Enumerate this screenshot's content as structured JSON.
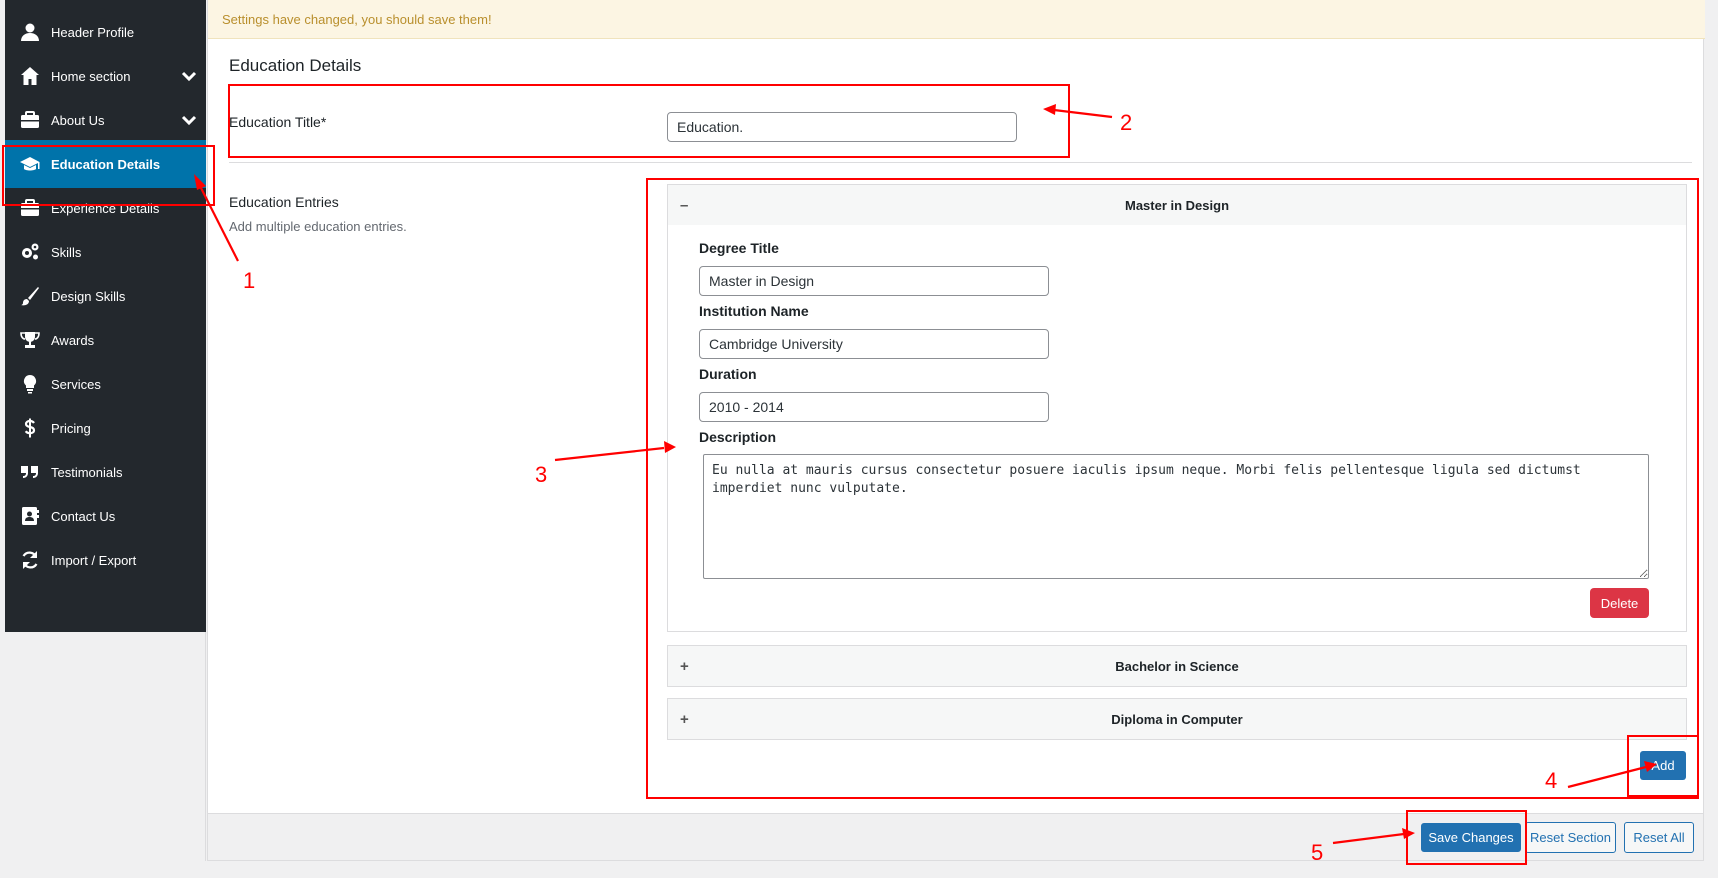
{
  "sidebar": {
    "items": [
      {
        "label": "Header Profile",
        "icon": "user-icon"
      },
      {
        "label": "Home section",
        "icon": "home-icon",
        "has_submenu": true
      },
      {
        "label": "About Us",
        "icon": "briefcase-icon",
        "has_submenu": true
      },
      {
        "label": "Education Details",
        "icon": "graduation-cap-icon",
        "active": true
      },
      {
        "label": "Experience Details",
        "icon": "briefcase-icon"
      },
      {
        "label": "Skills",
        "icon": "gears-icon"
      },
      {
        "label": "Design Skills",
        "icon": "brush-icon"
      },
      {
        "label": "Awards",
        "icon": "trophy-icon"
      },
      {
        "label": "Services",
        "icon": "lightbulb-icon"
      },
      {
        "label": "Pricing",
        "icon": "dollar-icon"
      },
      {
        "label": "Testimonials",
        "icon": "quote-icon"
      },
      {
        "label": "Contact Us",
        "icon": "address-book-icon"
      },
      {
        "label": "Import / Export",
        "icon": "refresh-icon"
      }
    ]
  },
  "notice": "Settings have changed, you should save them!",
  "section_title": "Education Details",
  "education_title": {
    "label": "Education Title*",
    "value": "Education."
  },
  "entries": {
    "label": "Education Entries",
    "description": "Add multiple education entries.",
    "expanded": {
      "title": "Master in Design",
      "toggle": "–",
      "fields": {
        "degree_label": "Degree Title",
        "degree_value": "Master in Design",
        "institution_label": "Institution Name",
        "institution_value": "Cambridge University",
        "duration_label": "Duration",
        "duration_value": "2010 - 2014",
        "description_label": "Description",
        "description_value": "Eu nulla at mauris cursus consectetur posuere iaculis ipsum neque. Morbi felis pellentesque ligula sed dictumst imperdiet nunc vulputate."
      },
      "delete_label": "Delete"
    },
    "collapsed": [
      {
        "title": "Bachelor in Science",
        "toggle": "+"
      },
      {
        "title": "Diploma in Computer",
        "toggle": "+"
      }
    ],
    "add_label": "Add"
  },
  "footer": {
    "save_label": "Save Changes",
    "reset_section_label": "Reset Section",
    "reset_all_label": "Reset All"
  },
  "annotations": {
    "n1": "1",
    "n2": "2",
    "n3": "3",
    "n4": "4",
    "n5": "5"
  },
  "colors": {
    "sidebar_bg": "#23282d",
    "active_bg": "#0073aa",
    "primary": "#2271b1",
    "danger": "#dc3545",
    "notice_text": "#b98f2d",
    "annotation": "#ff0000"
  }
}
